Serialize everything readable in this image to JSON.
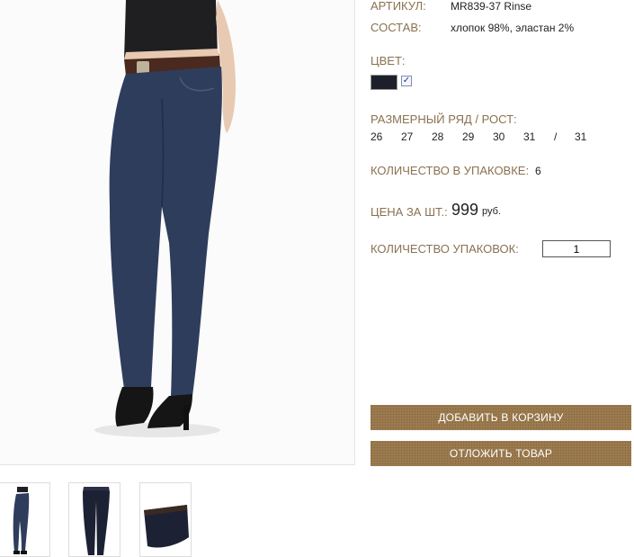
{
  "product": {
    "article_label": "АРТИКУЛ:",
    "article_value": "MR839-37 Rinse",
    "composition_label": "СОСТАВ:",
    "composition_value": "хлопок 98%, эластан 2%",
    "color_label": "ЦВЕТ:",
    "color_swatch": "#1d1f2a",
    "color_selected_mark": "✓",
    "size_label": "РАЗМЕРНЫЙ РЯД / РОСТ:",
    "sizes": [
      "26",
      "27",
      "28",
      "29",
      "30",
      "31",
      "/",
      "31"
    ],
    "pack_qty_label": "КОЛИЧЕСТВО В УПАКОВКЕ:",
    "pack_qty_value": "6",
    "price_label": "ЦЕНА ЗА ШТ.:",
    "price_value": "999",
    "price_currency": "руб.",
    "packs_label": "КОЛИЧЕСТВО УПАКОВОК:",
    "packs_value": "1"
  },
  "buttons": {
    "add_to_cart": "ДОБАВИТЬ В КОРЗИНУ",
    "defer": "ОТЛОЖИТЬ ТОВАР"
  },
  "colors": {
    "label_brown": "#8a7150",
    "button_brown": "#9a7a4e",
    "denim": "#2f3d5c"
  }
}
